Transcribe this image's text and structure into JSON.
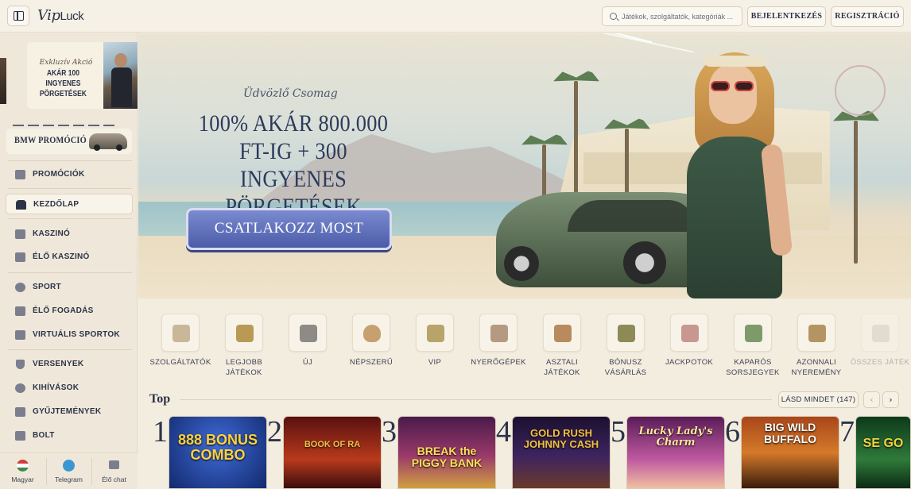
{
  "header": {
    "logo_script": "Vip",
    "logo_text": "Luck",
    "search_placeholder": "Játékok, szolgáltatók, kategóriák ...",
    "login_label": "BEJELENTKEZÉS",
    "register_label": "REGISZTRÁCIÓ"
  },
  "sidebar": {
    "promo_subtitle": "Exkluzív Akció",
    "promo_title": "AKÁR 100 INGYENES PÖRGETÉSEK",
    "bmw_label": "BMW PROMÓCIÓ",
    "items": [
      {
        "label": "PROMÓCIÓK",
        "icon": "gift-icon"
      },
      {
        "label": "KEZDŐLAP",
        "icon": "home-icon",
        "active": true
      },
      {
        "label": "KASZINÓ",
        "icon": "slot-machine-icon"
      },
      {
        "label": "ÉLŐ KASZINÓ",
        "icon": "cards-icon"
      },
      {
        "label": "SPORT",
        "icon": "soccer-ball-icon"
      },
      {
        "label": "ÉLŐ FOGADÁS",
        "icon": "live-bet-icon"
      },
      {
        "label": "VIRTUÁLIS SPORTOK",
        "icon": "virtual-sports-icon"
      },
      {
        "label": "VERSENYEK",
        "icon": "trophy-icon"
      },
      {
        "label": "KIHÍVÁSOK",
        "icon": "medal-icon"
      },
      {
        "label": "GYŰJTEMÉNYEK",
        "icon": "collection-icon"
      },
      {
        "label": "BOLT",
        "icon": "shop-icon"
      }
    ],
    "bottom": [
      {
        "label": "Magyar",
        "icon": "hungarian-flag-icon"
      },
      {
        "label": "Telegram",
        "icon": "telegram-icon"
      },
      {
        "label": "Élő chat",
        "icon": "chat-icon"
      }
    ]
  },
  "hero": {
    "script": "Üdvözlő Csomag",
    "title": "100% AKÁR 800.000 FT-IG + 300 INGYENES PÖRGETÉSEK",
    "cta": "CSATLAKOZZ MOST"
  },
  "categories": [
    {
      "label": "SZOLGÁLTATÓK",
      "icon": "providers-icon",
      "color": "#c9b79a"
    },
    {
      "label": "LEGJOBB JÁTÉKOK",
      "icon": "crown-icon",
      "color": "#b99a54"
    },
    {
      "label": "ÚJ",
      "icon": "megaphone-icon",
      "color": "#8e8a85"
    },
    {
      "label": "NÉPSZERŰ",
      "icon": "flame-icon",
      "color": "#c6a070"
    },
    {
      "label": "VIP",
      "icon": "vip-icon",
      "color": "#b8a46a"
    },
    {
      "label": "NYERŐGÉPEK",
      "icon": "slot-icon",
      "color": "#b59a82"
    },
    {
      "label": "ASZTALI JÁTÉKOK",
      "icon": "dice-icon",
      "color": "#b88a5e"
    },
    {
      "label": "BÓNUSZ VÁSÁRLÁS",
      "icon": "gift-box-icon",
      "color": "#8d8a55"
    },
    {
      "label": "JACKPOTOK",
      "icon": "playing-cards-icon",
      "color": "#c89890"
    },
    {
      "label": "KAPARÓS SORSJEGYEK",
      "icon": "scratch-card-icon",
      "color": "#7f9a6a"
    },
    {
      "label": "AZONNALI NYEREMÉNY",
      "icon": "trophy-cup-icon",
      "color": "#b49462"
    },
    {
      "label": "ÖSSZES JÁTÉK",
      "icon": "all-games-icon",
      "color": "#c8bcb0"
    }
  ],
  "top_section": {
    "title": "Top",
    "see_all": "LÁSD MINDET (147)",
    "prev_icon": "‹",
    "next_icon": "›",
    "games": [
      {
        "rank": "1",
        "name": "888 BONUS COMBO",
        "bg": "#1f3c8f"
      },
      {
        "rank": "2",
        "name": "BOOK OF RA",
        "bg": "#7a1a1a"
      },
      {
        "rank": "3",
        "name": "BREAK the PIGGY BANK",
        "bg": "#6b1f5c"
      },
      {
        "rank": "4",
        "name": "GOLD RUSH JOHNNY CASH",
        "bg": "#2e1a4a"
      },
      {
        "rank": "5",
        "name": "Lucky Lady's Charm",
        "bg": "#7a2c6f"
      },
      {
        "rank": "6",
        "name": "BIG WILD BUFFALO",
        "bg": "#8a3a14"
      },
      {
        "rank": "7",
        "name": "SE GO",
        "bg": "#1d5a2d"
      }
    ]
  }
}
